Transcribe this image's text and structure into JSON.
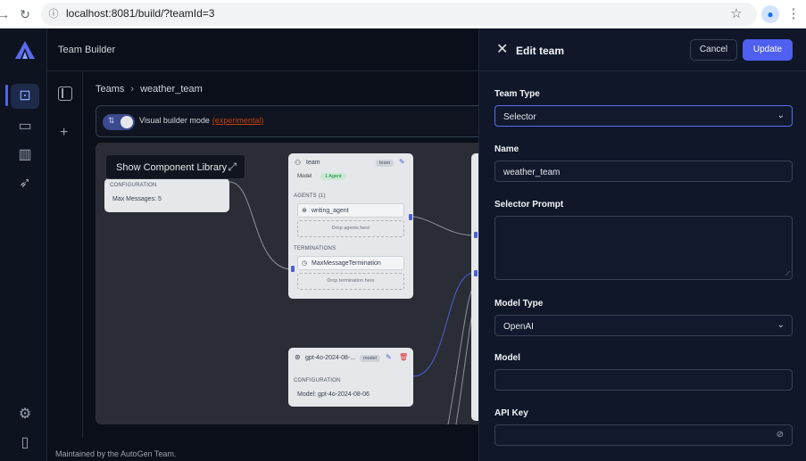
{
  "browser": {
    "url": "localhost:8081/build/?teamId=3",
    "icons": [
      "forward-icon",
      "reload-icon",
      "site-info-icon",
      "bookmark-star-icon",
      "profile-icon",
      "menu-dots-icon"
    ]
  },
  "app": {
    "header_title": "Team Builder",
    "footer_text": "Maintained by the AutoGen Team.",
    "nav_icons": [
      "bot-icon",
      "chat-icon",
      "gallery-icon",
      "rocket-icon",
      "settings-icon",
      "sidebar-toggle-icon"
    ],
    "accent_color": "#4f5ff0"
  },
  "breadcrumb": {
    "root": "Teams",
    "current": "weather_team"
  },
  "toolbar": {
    "mode_label": "Visual builder mode",
    "mode_badge": "(experimental)",
    "mode_enabled": true
  },
  "canvas": {
    "library_button": "Show Component Library",
    "termination_node": {
      "section": "CONFIGURATION",
      "value": "Max Messages: 5"
    },
    "team_node": {
      "title": "team",
      "tag": "team",
      "model_label": "Model",
      "agent_pill": "1 Agent",
      "agents_section": "AGENTS (1)",
      "agent_name": "writing_agent",
      "agents_drop": "Drop agents here",
      "terminations_section": "TERMINATIONS",
      "termination_name": "MaxMessageTermination",
      "terminations_drop": "Drop termination here"
    },
    "model_node": {
      "title": "gpt-4o-2024-08-...",
      "tag": "model",
      "section": "CONFIGURATION",
      "value": "Model: gpt-4o-2024-08-06"
    }
  },
  "drawer": {
    "title": "Edit team",
    "cancel": "Cancel",
    "update": "Update",
    "team_type_label": "Team Type",
    "team_type_value": "Selector",
    "name_label": "Name",
    "name_value": "weather_team",
    "selector_prompt_label": "Selector Prompt",
    "selector_prompt_value": "",
    "model_type_label": "Model Type",
    "model_type_value": "OpenAI",
    "model_label": "Model",
    "model_value": "",
    "api_key_label": "API Key",
    "api_key_value": ""
  }
}
